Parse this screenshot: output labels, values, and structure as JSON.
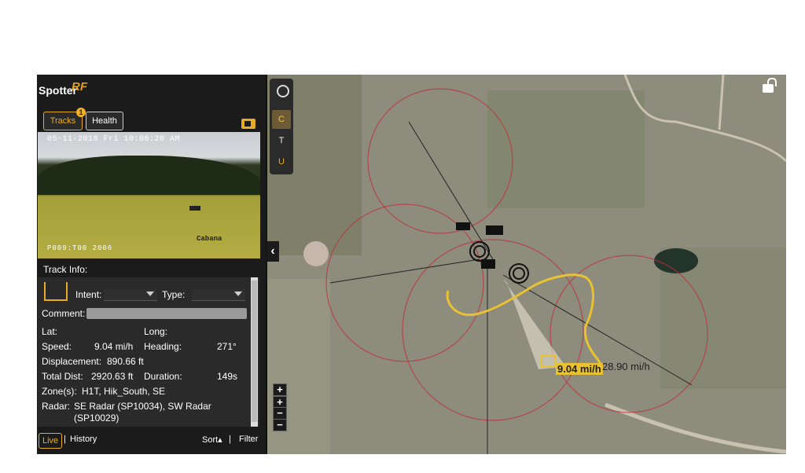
{
  "app": {
    "brand_part1": "Spotter",
    "brand_part2": "RF"
  },
  "tabs": {
    "tracks": "Tracks",
    "health": "Health",
    "tracks_badge": "1"
  },
  "camera": {
    "timestamp": "05-11-2018 Fri 10:06:20 AM",
    "camera_id": "P009:T00  2006",
    "location_label": "Cabana"
  },
  "track_info": {
    "title": "Track Info:",
    "intent_label": "Intent:",
    "type_label": "Type:",
    "comment_label": "Comment:",
    "lat_label": "Lat:",
    "long_label": "Long:",
    "speed_label": "Speed:",
    "speed_value": "9.04 mi/h",
    "heading_label": "Heading:",
    "heading_value": "271°",
    "displacement_label": "Displacement:",
    "displacement_value": "890.66 ft",
    "total_dist_label": "Total Dist:",
    "total_dist_value": "2920.63 ft",
    "duration_label": "Duration:",
    "duration_value": "149s",
    "zones_label": "Zone(s):",
    "zones_value": "H1T, Hik_South, SE",
    "radar_label": "Radar:",
    "radar_value_line1": "SE Radar (SP10034), SW Radar",
    "radar_value_line2": "(SP10029)"
  },
  "bottom_bar": {
    "live": "Live",
    "separator": "|",
    "history": "History",
    "sort": "Sort▴",
    "filter": "Filter"
  },
  "map": {
    "layers": {
      "c": "C",
      "t": "T",
      "u": "U"
    },
    "zoom_in": "+",
    "zoom_in2": "+",
    "zoom_out": "−",
    "zoom_out2": "−",
    "collapse": "‹",
    "speed_label": "9.04 mi/h",
    "secondary_speed_label": "28.90 mi/h",
    "icons": [
      "cctv-icon",
      "lock-icon",
      "radar-icon",
      "camera-icon"
    ]
  },
  "colors": {
    "accent": "#e7ad22",
    "track_path": "#e8c233",
    "radar_ring": "#c0303a",
    "panel_bg": "#1b1b1b"
  }
}
